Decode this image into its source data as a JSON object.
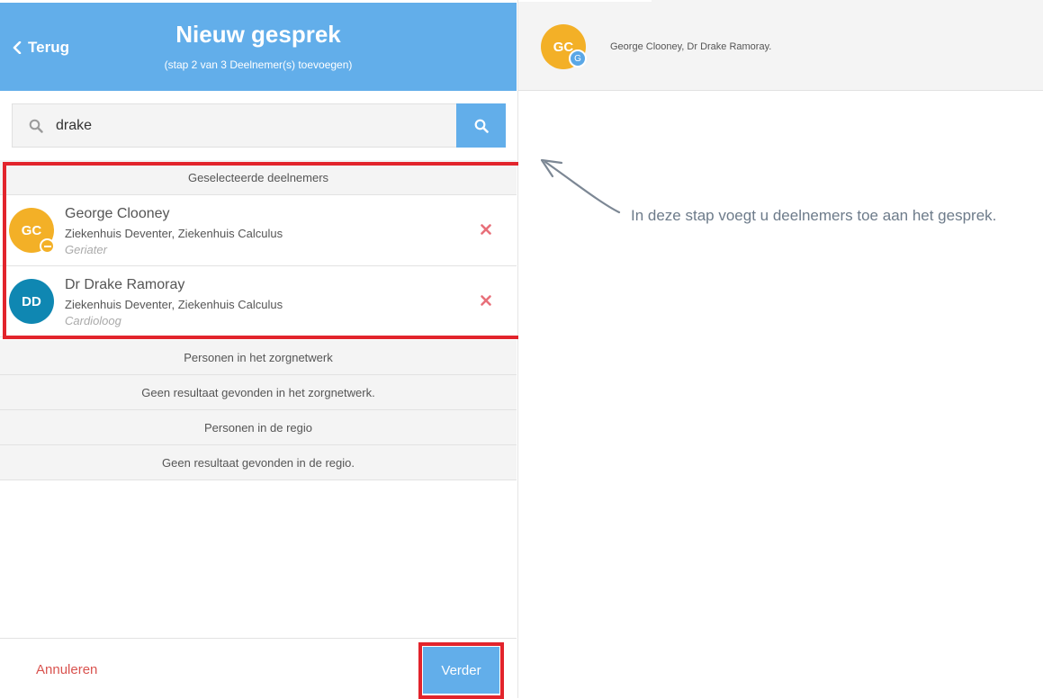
{
  "header": {
    "back_label": "Terug",
    "title": "Nieuw gesprek",
    "subtitle": "(stap 2 van 3 Deelnemer(s) toevoegen)"
  },
  "search": {
    "value": "drake",
    "placeholder": ""
  },
  "sections": {
    "selected": "Geselecteerde deelnemers",
    "network": "Personen in het zorgnetwerk",
    "network_empty": "Geen resultaat gevonden in het zorgnetwerk.",
    "region": "Personen in de regio",
    "region_empty": "Geen resultaat gevonden in de regio."
  },
  "participants": [
    {
      "initials": "GC",
      "name": "George Clooney",
      "organization": "Ziekenhuis Deventer, Ziekenhuis Calculus",
      "role": "Geriater",
      "avatar_color": "#f3b027"
    },
    {
      "initials": "DD",
      "name": "Dr Drake Ramoray",
      "organization": "Ziekenhuis Deventer, Ziekenhuis Calculus",
      "role": "Cardioloog",
      "avatar_color": "#0f87b2"
    }
  ],
  "footer": {
    "cancel_label": "Annuleren",
    "next_label": "Verder"
  },
  "conversation": {
    "avatar_initials": "GC",
    "avatar_badge": "G",
    "participants_text": "George Clooney, Dr Drake Ramoray."
  },
  "hint_text": "In deze stap voegt u deelnemers toe aan het gesprek.",
  "colors": {
    "accent": "#62aeea",
    "highlight": "#e2242c",
    "remove": "#e8707a"
  }
}
